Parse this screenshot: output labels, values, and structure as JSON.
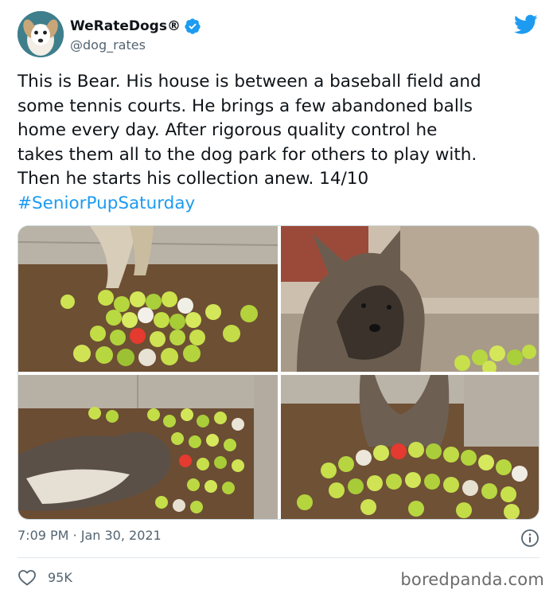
{
  "author": {
    "display_name": "WeRateDogs®",
    "handle": "@dog_rates",
    "verified": true,
    "avatar_icon": "dog-avatar"
  },
  "brand": {
    "icon": "twitter-bird-icon",
    "color": "#1d9bf0"
  },
  "tweet": {
    "lines": [
      "This is Bear. His house is between a baseball field and",
      "some tennis courts. He brings a few abandoned balls",
      "home every day. After rigorous quality control he",
      "takes them all to the dog park for others to play with.",
      "Then he starts his collection anew. 14/10"
    ],
    "hashtag": "#SeniorPupSaturday",
    "photos": [
      {
        "subject": "dog-legs-with-ball-pile"
      },
      {
        "subject": "dog-portrait-near-balls"
      },
      {
        "subject": "dog-lying-among-balls"
      },
      {
        "subject": "dog-sitting-behind-balls"
      }
    ]
  },
  "footer": {
    "timestamp": "7:09 PM · Jan 30, 2021",
    "like_count": "95K",
    "info_icon": "info-icon",
    "like_icon": "heart-icon"
  },
  "watermark": {
    "text": "boredpanda.com"
  }
}
